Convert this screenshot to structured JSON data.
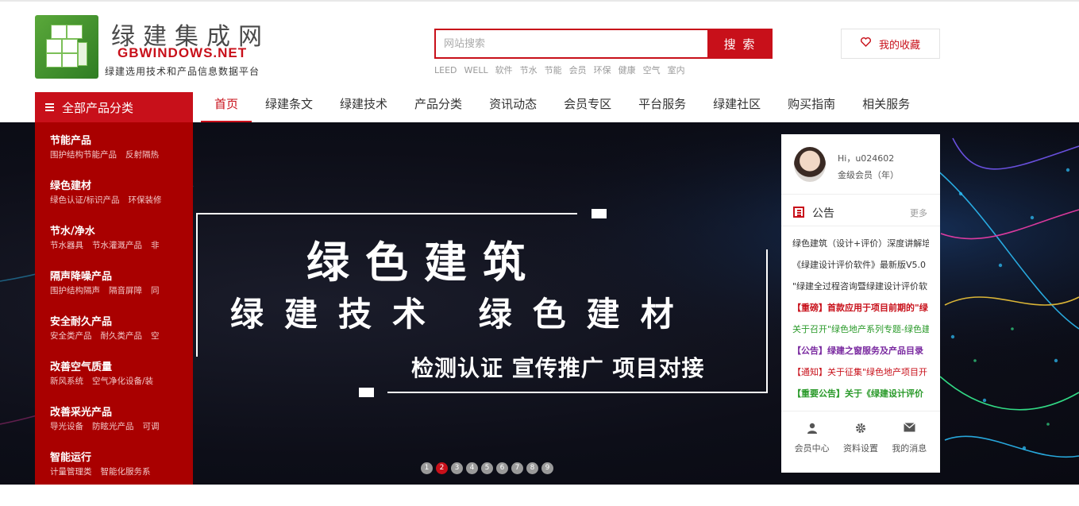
{
  "logo": {
    "title_cn": "绿建集成网",
    "title_en": "GBWINDOWS.NET",
    "tagline": "绿建选用技术和产品信息数据平台"
  },
  "search": {
    "placeholder": "网站搜索",
    "button": "搜 索",
    "hot_keywords": [
      "LEED",
      "WELL",
      "软件",
      "节水",
      "节能",
      "会员",
      "环保",
      "健康",
      "空气",
      "室内"
    ]
  },
  "favorites": {
    "label": "我的收藏",
    "icon": "heart-icon"
  },
  "category_button": {
    "label": "全部产品分类",
    "icon": "menu-icon"
  },
  "nav": {
    "items": [
      "首页",
      "绿建条文",
      "绿建技术",
      "产品分类",
      "资讯动态",
      "会员专区",
      "平台服务",
      "绿建社区",
      "购买指南",
      "相关服务"
    ],
    "active": "首页"
  },
  "categories": [
    {
      "title": "节能产品",
      "subs": [
        "围护结构节能产品",
        "反射隔热"
      ]
    },
    {
      "title": "绿色建材",
      "subs": [
        "绿色认证/标识产品",
        "环保装修"
      ]
    },
    {
      "title": "节水/净水",
      "subs": [
        "节水器具",
        "节水灌溉产品",
        "非"
      ]
    },
    {
      "title": "隔声降噪产品",
      "subs": [
        "围护结构隔声",
        "隔音屏障",
        "同"
      ]
    },
    {
      "title": "安全耐久产品",
      "subs": [
        "安全类产品",
        "耐久类产品",
        "空"
      ]
    },
    {
      "title": "改善空气质量",
      "subs": [
        "新风系统",
        "空气净化设备/装"
      ]
    },
    {
      "title": "改善采光产品",
      "subs": [
        "导光设备",
        "防眩光产品",
        "可调"
      ]
    },
    {
      "title": "智能运行",
      "subs": [
        "计量管理类",
        "智能化服务系"
      ]
    }
  ],
  "banner": {
    "line1": "绿色建筑",
    "line2": "绿建技术  绿色建材",
    "line3": "检测认证 宣传推广 项目对接",
    "slides": [
      "1",
      "2",
      "3",
      "4",
      "5",
      "6",
      "7",
      "8",
      "9"
    ],
    "active_slide": "2"
  },
  "user": {
    "greeting": "Hi，u024602",
    "level": "金级会员（年）"
  },
  "notice": {
    "title": "公告",
    "more": "更多",
    "items": [
      {
        "text": "绿色建筑（设计+评价）深度讲解培",
        "style": "normal"
      },
      {
        "text": "《绿建设计评价软件》最新版V5.0",
        "style": "normal"
      },
      {
        "text": "\"绿建全过程咨询暨绿建设计评价软",
        "style": "normal"
      },
      {
        "text": "【重磅】首款应用于项目前期的\"绿",
        "style": "red"
      },
      {
        "text": "关于召开\"绿色地产系列专题-绿色建",
        "style": "green"
      },
      {
        "text": "【公告】绿建之窗服务及产品目录",
        "style": "purple"
      },
      {
        "text": "【通知】关于征集\"绿色地产项目开",
        "style": "redn"
      },
      {
        "text": "【重要公告】关于《绿建设计评价",
        "style": "greenb"
      }
    ]
  },
  "quick_links": [
    {
      "label": "会员中心",
      "icon": "user-icon"
    },
    {
      "label": "资料设置",
      "icon": "gear-icon"
    },
    {
      "label": "我的消息",
      "icon": "envelope-icon"
    }
  ],
  "colors": {
    "brand_red": "#c8101a",
    "category_bg": "#a90000",
    "logo_green": "#4a9a2f"
  }
}
